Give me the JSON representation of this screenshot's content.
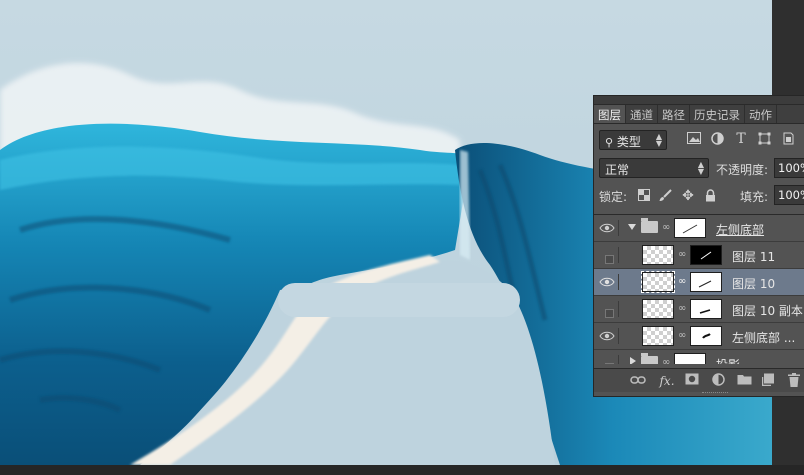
{
  "panel": {
    "tabs": [
      {
        "label": "图层",
        "active": true
      },
      {
        "label": "通道",
        "active": false
      },
      {
        "label": "路径",
        "active": false
      },
      {
        "label": "历史记录",
        "active": false
      },
      {
        "label": "动作",
        "active": false
      }
    ],
    "filter": {
      "search_glyph": "⚲",
      "label": "类型"
    },
    "blend_mode": "正常",
    "opacity_label": "不透明度:",
    "opacity_value": "100%",
    "lock_label": "锁定:",
    "fill_label": "填充:",
    "fill_value": "100%",
    "layers": [
      {
        "name": "左侧底部",
        "type": "group",
        "expanded": true,
        "visible": true
      },
      {
        "name": "图层 11",
        "type": "layer",
        "visible": false,
        "selected": false,
        "mask": "dark"
      },
      {
        "name": "图层 10",
        "type": "layer",
        "visible": true,
        "selected": true,
        "mask": "white"
      },
      {
        "name": "图层 10 副本",
        "type": "layer",
        "visible": false,
        "selected": false,
        "mask": "white"
      },
      {
        "name": "左侧底部 ...",
        "type": "layer",
        "visible": true,
        "selected": false,
        "mask": "white"
      },
      {
        "name": "投影",
        "type": "group",
        "expanded": false,
        "visible": false
      }
    ],
    "footer_fx": "fx."
  },
  "colors": {
    "panel_bg": "#535353",
    "selected_layer": "#6d7a8c",
    "canvas_sky": "#c2d6e0",
    "wave_dark": "#0c5a85",
    "wave_light": "#27a9d4"
  }
}
